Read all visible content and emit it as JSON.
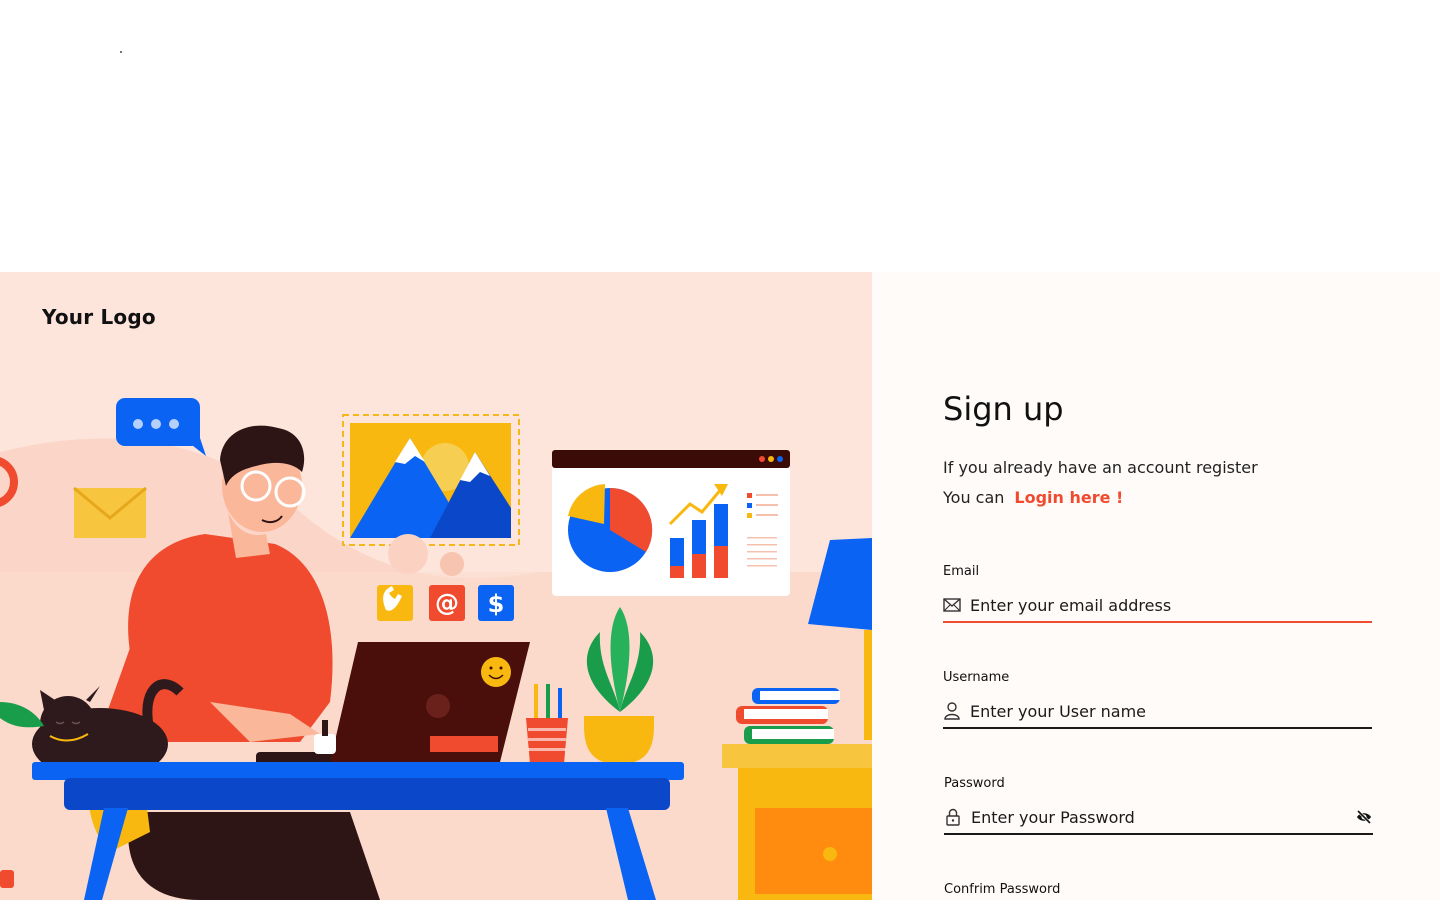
{
  "brand": {
    "logo_text": "Your Logo"
  },
  "signup": {
    "title": "Sign up",
    "subtitle": "If you already have an account register",
    "login_prefix": "You can",
    "login_link": "Login here !"
  },
  "fields": {
    "email": {
      "label": "Email",
      "placeholder": "Enter your email address",
      "icon": "mail-icon"
    },
    "username": {
      "label": "Username",
      "placeholder": "Enter your User name",
      "icon": "user-icon"
    },
    "password": {
      "label": "Password",
      "placeholder": "Enter your Password",
      "icon": "lock-icon",
      "toggle_icon": "eye-off-icon"
    },
    "confirm_password": {
      "label": "Confrim Password"
    }
  },
  "colors": {
    "accent": "#f04b2f",
    "illustration_bg": "#fde5dc",
    "form_bg": "#fffbf9"
  }
}
